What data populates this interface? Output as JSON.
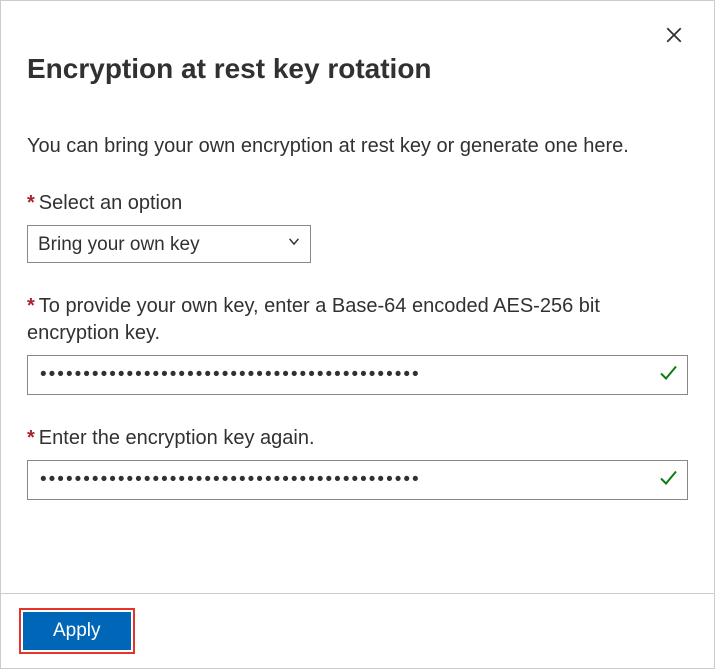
{
  "header": {
    "title": "Encryption at rest key rotation"
  },
  "description": "You can bring your own encryption at rest key or generate one here.",
  "fields": {
    "option": {
      "label": "Select an option",
      "selected": "Bring your own key"
    },
    "key1": {
      "label": "To provide your own key, enter a Base-64 encoded AES-256 bit encryption key.",
      "value": "••••••••••••••••••••••••••••••••••••••••••••"
    },
    "key2": {
      "label": "Enter the encryption key again.",
      "value": "••••••••••••••••••••••••••••••••••••••••••••"
    }
  },
  "footer": {
    "apply_label": "Apply"
  },
  "required_mark": "*"
}
